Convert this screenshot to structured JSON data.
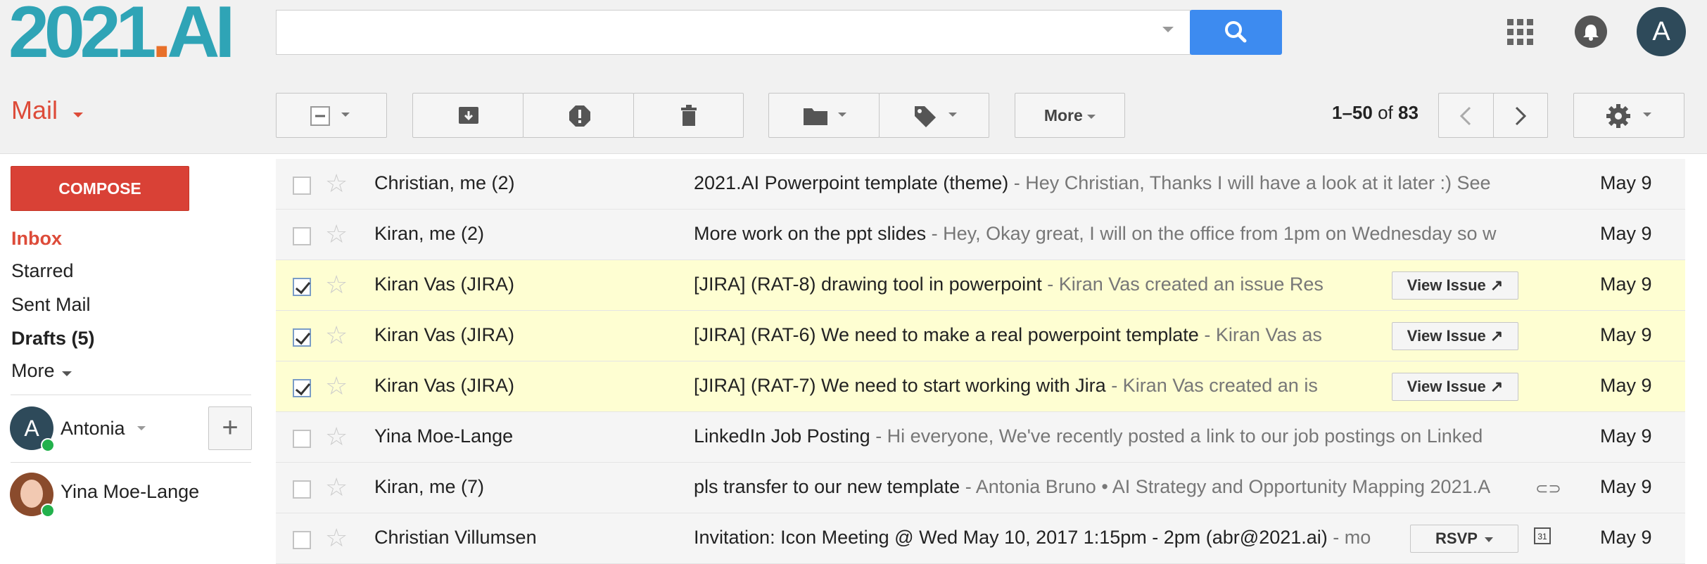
{
  "brand": {
    "logo_main": "2021",
    "logo_dot": ".",
    "logo_tail": "AI"
  },
  "search": {
    "placeholder": "",
    "value": ""
  },
  "header": {
    "avatar_letter": "A"
  },
  "mailbar": {
    "mail_label": "Mail",
    "more_label": "More",
    "range_start_end": "1–50",
    "range_of": "of",
    "range_total": "83"
  },
  "sidebar": {
    "compose_label": "COMPOSE",
    "items": [
      {
        "label": "Inbox"
      },
      {
        "label": "Starred"
      },
      {
        "label": "Sent Mail"
      },
      {
        "label": "Drafts (5)"
      },
      {
        "label": "More"
      }
    ],
    "account": {
      "initial": "A",
      "name": "Antonia"
    },
    "add_label": "+",
    "contacts": [
      {
        "name": "Yina Moe-Lange"
      }
    ]
  },
  "emails": [
    {
      "sender": "Christian, me (2)",
      "subject": "2021.AI Powerpoint template (theme)",
      "snippet": " - Hey Christian, Thanks I will have a look at it later :) See",
      "date": "May 9",
      "checked": false,
      "highlight": false
    },
    {
      "sender": "Kiran, me (2)",
      "subject": "More work on the ppt slides",
      "snippet": " - Hey, Okay great, I will on the office from 1pm on Wednesday so w",
      "date": "May 9",
      "checked": false,
      "highlight": false
    },
    {
      "sender": "Kiran Vas (JIRA)",
      "subject": "[JIRA] (RAT-8) drawing tool in powerpoint",
      "snippet": " - Kiran Vas created an issue Res",
      "date": "May 9",
      "checked": true,
      "highlight": true,
      "action": "View Issue ↗"
    },
    {
      "sender": "Kiran Vas (JIRA)",
      "subject": "[JIRA] (RAT-6) We need to make a real powerpoint template",
      "snippet": " - Kiran Vas as",
      "date": "May 9",
      "checked": true,
      "highlight": true,
      "action": "View Issue ↗"
    },
    {
      "sender": "Kiran Vas (JIRA)",
      "subject": "[JIRA] (RAT-7) We need to start working with Jira",
      "snippet": " - Kiran Vas created an is",
      "date": "May 9",
      "checked": true,
      "highlight": true,
      "action": "View Issue ↗"
    },
    {
      "sender": "Yina Moe-Lange",
      "subject": "LinkedIn Job Posting",
      "snippet": " - Hi everyone, We've recently posted a link to our job postings on Linked",
      "date": "May 9",
      "checked": false,
      "highlight": false
    },
    {
      "sender": "Kiran, me (7)",
      "subject": "pls transfer to our new template",
      "snippet": " - Antonia Bruno • AI Strategy and Opportunity Mapping 2021.A",
      "date": "May 9",
      "checked": false,
      "highlight": false,
      "attachment": true
    },
    {
      "sender": "Christian Villumsen",
      "subject": "Invitation: Icon Meeting @ Wed May 10, 2017 1:15pm - 2pm (abr@2021.ai)",
      "snippet": " - mo",
      "date": "May 9",
      "checked": false,
      "highlight": false,
      "action": "RSVP",
      "calendar": "31"
    }
  ],
  "colors": {
    "accent_red": "#dd4b39",
    "search_blue": "#3d8bf0",
    "logo_teal": "#2fa4b6",
    "logo_orange": "#e8702a",
    "highlight_row": "#fefed2",
    "read_row": "#f5f5f5"
  },
  "icons": [
    "search-icon",
    "apps-grid-icon",
    "bell-icon",
    "archive-icon",
    "report-spam-icon",
    "trash-icon",
    "folder-icon",
    "label-icon",
    "chevron-left-icon",
    "chevron-right-icon",
    "gear-icon",
    "star-icon",
    "paperclip-icon",
    "calendar-icon"
  ]
}
